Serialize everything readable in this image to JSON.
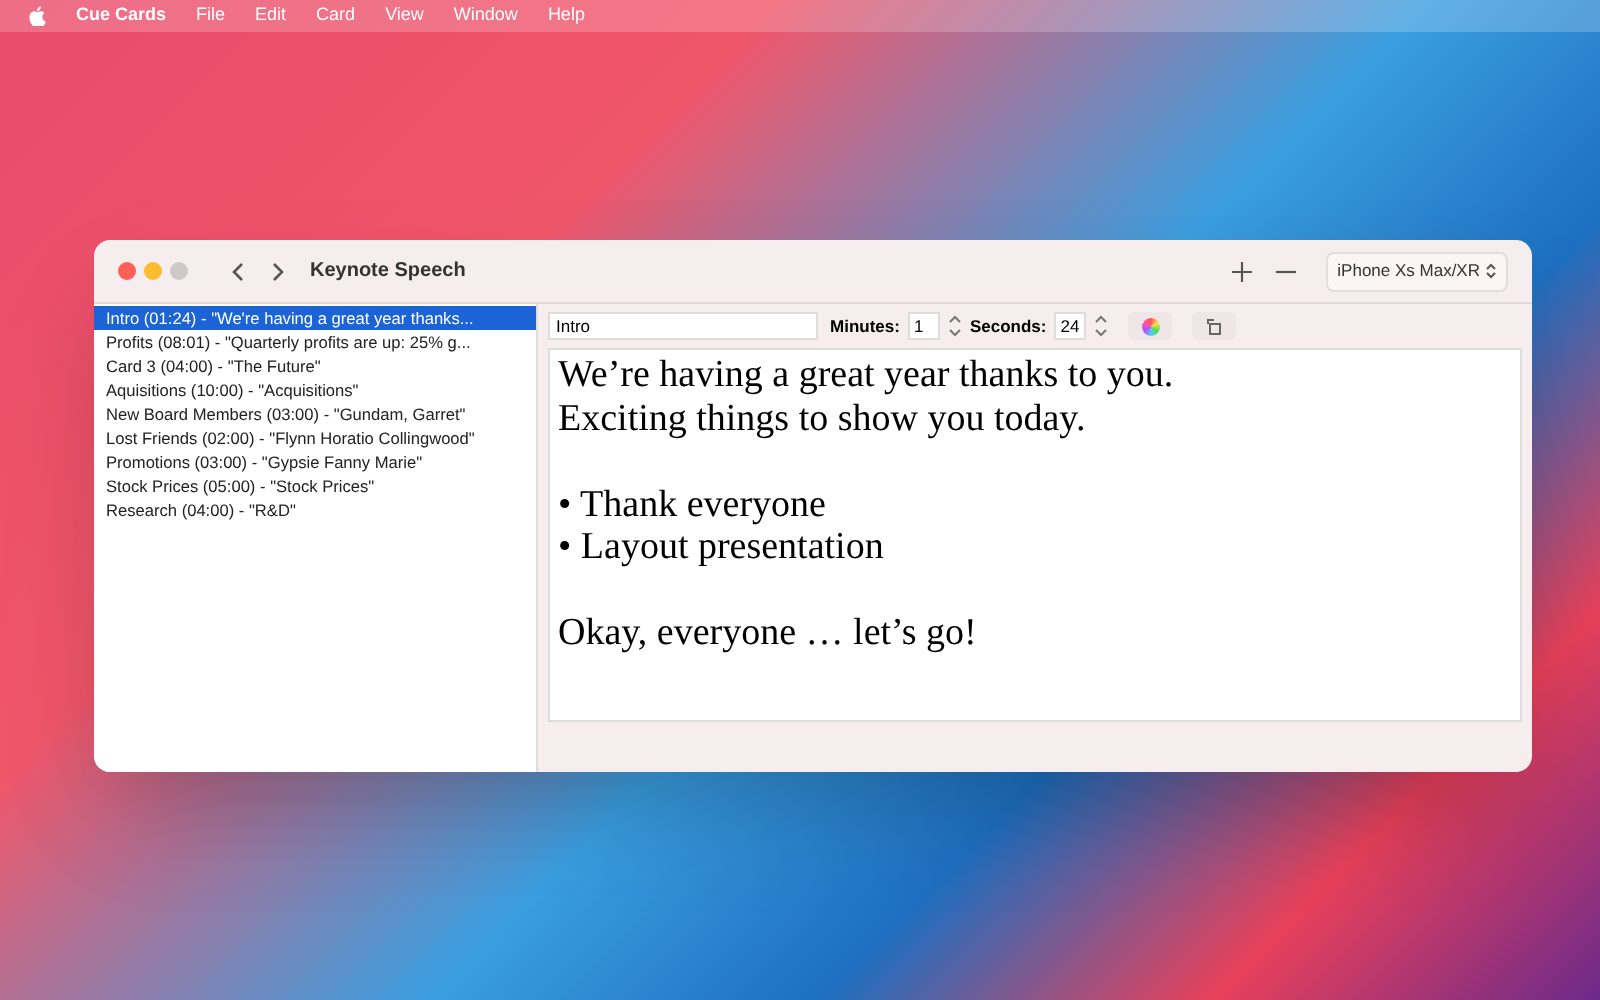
{
  "menu_bar": {
    "app": "Cue Cards",
    "items": [
      "File",
      "Edit",
      "Card",
      "View",
      "Window",
      "Help"
    ]
  },
  "window": {
    "title": "Keynote Speech",
    "device": "iPhone Xs Max/XR"
  },
  "sidebar": {
    "items": [
      {
        "label": "Intro (01:24) - \"We're having a great year thanks...",
        "selected": true
      },
      {
        "label": "Profits (08:01) - \"Quarterly profits are up: 25% g...",
        "selected": false
      },
      {
        "label": "Card 3 (04:00) - \"The Future\"",
        "selected": false
      },
      {
        "label": "Aquisitions (10:00) - \"Acquisitions\"",
        "selected": false
      },
      {
        "label": "New Board Members (03:00) - \"Gundam, Garret\"",
        "selected": false
      },
      {
        "label": "Lost Friends (02:00) - \"Flynn Horatio Collingwood\"",
        "selected": false
      },
      {
        "label": "Promotions (03:00) - \"Gypsie Fanny Marie\"",
        "selected": false
      },
      {
        "label": "Stock Prices (05:00) - \"Stock Prices\"",
        "selected": false
      },
      {
        "label": "Research (04:00) - \"R&D\"",
        "selected": false
      }
    ]
  },
  "card_toolbar": {
    "title_value": "Intro",
    "minutes_label": "Minutes:",
    "minutes": "1",
    "seconds_label": "Seconds:",
    "seconds": "24"
  },
  "editor": {
    "paragraphs": [
      [
        "We’re having a great year thanks to you.",
        "Exciting things to show you today."
      ],
      [
        "• Thank everyone",
        "• Layout presentation"
      ],
      [
        "Okay, everyone … let’s go!"
      ]
    ]
  }
}
